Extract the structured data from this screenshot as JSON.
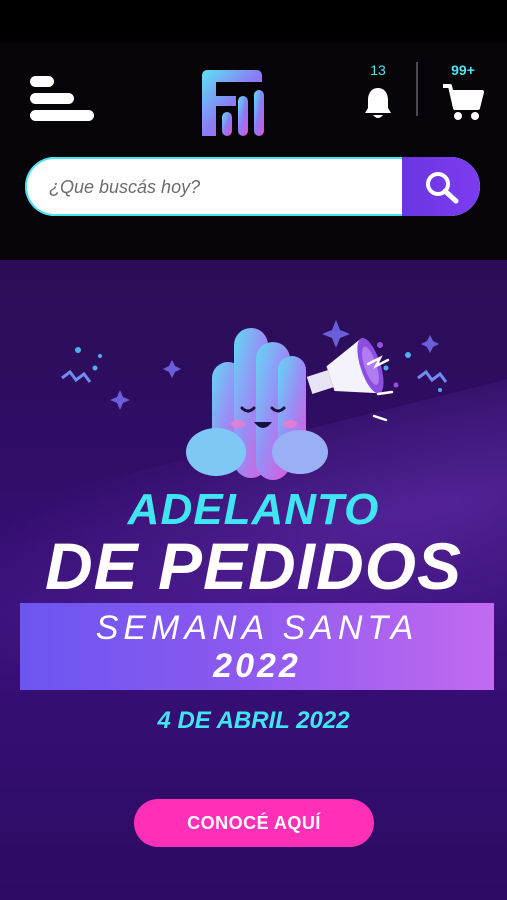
{
  "header": {
    "menu_icon": "hamburger-icon",
    "logo_icon": "brand-logo",
    "notifications": {
      "icon": "bell-icon",
      "count": "13"
    },
    "cart": {
      "icon": "cart-icon",
      "count": "99+"
    }
  },
  "search": {
    "placeholder": "¿Que buscás hoy?",
    "button_icon": "search-icon"
  },
  "banner": {
    "title_top": "ADELANTO",
    "title_main": "DE PEDIDOS",
    "subtitle_line1": "SEMANA SANTA",
    "subtitle_line2": "2022",
    "date": "4 DE ABRIL 2022",
    "cta_label": "CONOCÉ AQUÍ",
    "mascot_icon": "mascot-megaphone-illustration"
  },
  "colors": {
    "accent_cyan": "#3fe6f2",
    "cta_pink": "#ff2fb7",
    "search_button": "#7c3cf0",
    "banner_bg": "#300d66"
  }
}
